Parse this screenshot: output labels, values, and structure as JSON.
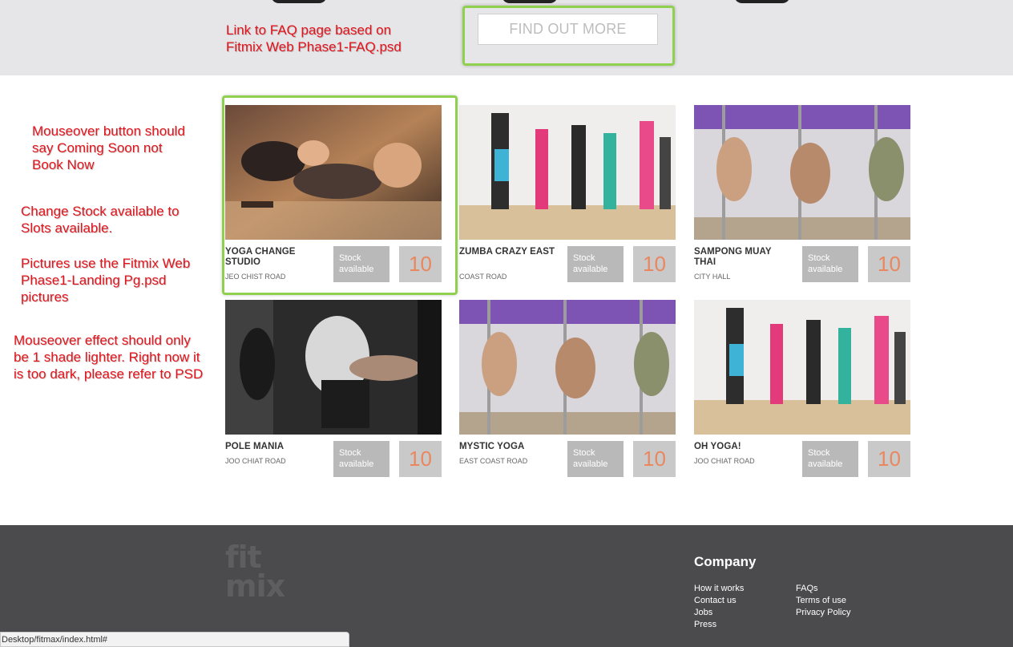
{
  "hero": {
    "find_out_more_label": "FIND OUT MORE"
  },
  "annotations": {
    "faq_link_1": "Link to FAQ page based on",
    "faq_link_2": "Fitmix Web Phase1-FAQ.psd",
    "mouseover_button_1": "Mouseover button should",
    "mouseover_button_2": "say Coming Soon not",
    "mouseover_button_3": "Book Now",
    "change_stock_1": "Change Stock available to",
    "change_stock_2": "Slots available.",
    "pictures_1": "Pictures use the Fitmix Web",
    "pictures_2": "Phase1-Landing Pg.psd",
    "pictures_3": "pictures",
    "mouseover_effect_1": "Mouseover effect should only",
    "mouseover_effect_2": "be 1 shade lighter. Right now it",
    "mouseover_effect_3": "is too dark, please refer to PSD"
  },
  "cards": [
    {
      "name": "YOGA CHANGE STUDIO",
      "address": "JEO CHIST ROAD",
      "stock_label": "Stock available",
      "count": "10"
    },
    {
      "name": "ZUMBA CRAZY EAST",
      "address": "COAST ROAD",
      "stock_label": "Stock available",
      "count": "10"
    },
    {
      "name": "SAMPONG MUAY THAI",
      "address": "CITY HALL",
      "stock_label": "Stock available",
      "count": "10"
    },
    {
      "name": "POLE MANIA",
      "address": "JOO CHIAT ROAD",
      "stock_label": "Stock available",
      "count": "10"
    },
    {
      "name": "MYSTIC YOGA",
      "address": "EAST COAST ROAD",
      "stock_label": "Stock available",
      "count": "10"
    },
    {
      "name": "OH YOGA!",
      "address": "JOO CHIAT ROAD",
      "stock_label": "Stock available",
      "count": "10"
    }
  ],
  "footer": {
    "logo_line1": "fit",
    "logo_line2": "mix",
    "company_heading": "Company",
    "links_col1": [
      "How it works",
      "Contact us",
      "Jobs",
      "Press"
    ],
    "links_col2": [
      "FAQs",
      "Terms of use",
      "Privacy Policy"
    ]
  },
  "status_bar": {
    "url": "Desktop/fitmax/index.html#"
  },
  "colors": {
    "highlight_border": "#8fd14f",
    "annotation_text": "#e3131b",
    "count_text": "#e9875f",
    "footer_bg": "#4b4b4d"
  }
}
